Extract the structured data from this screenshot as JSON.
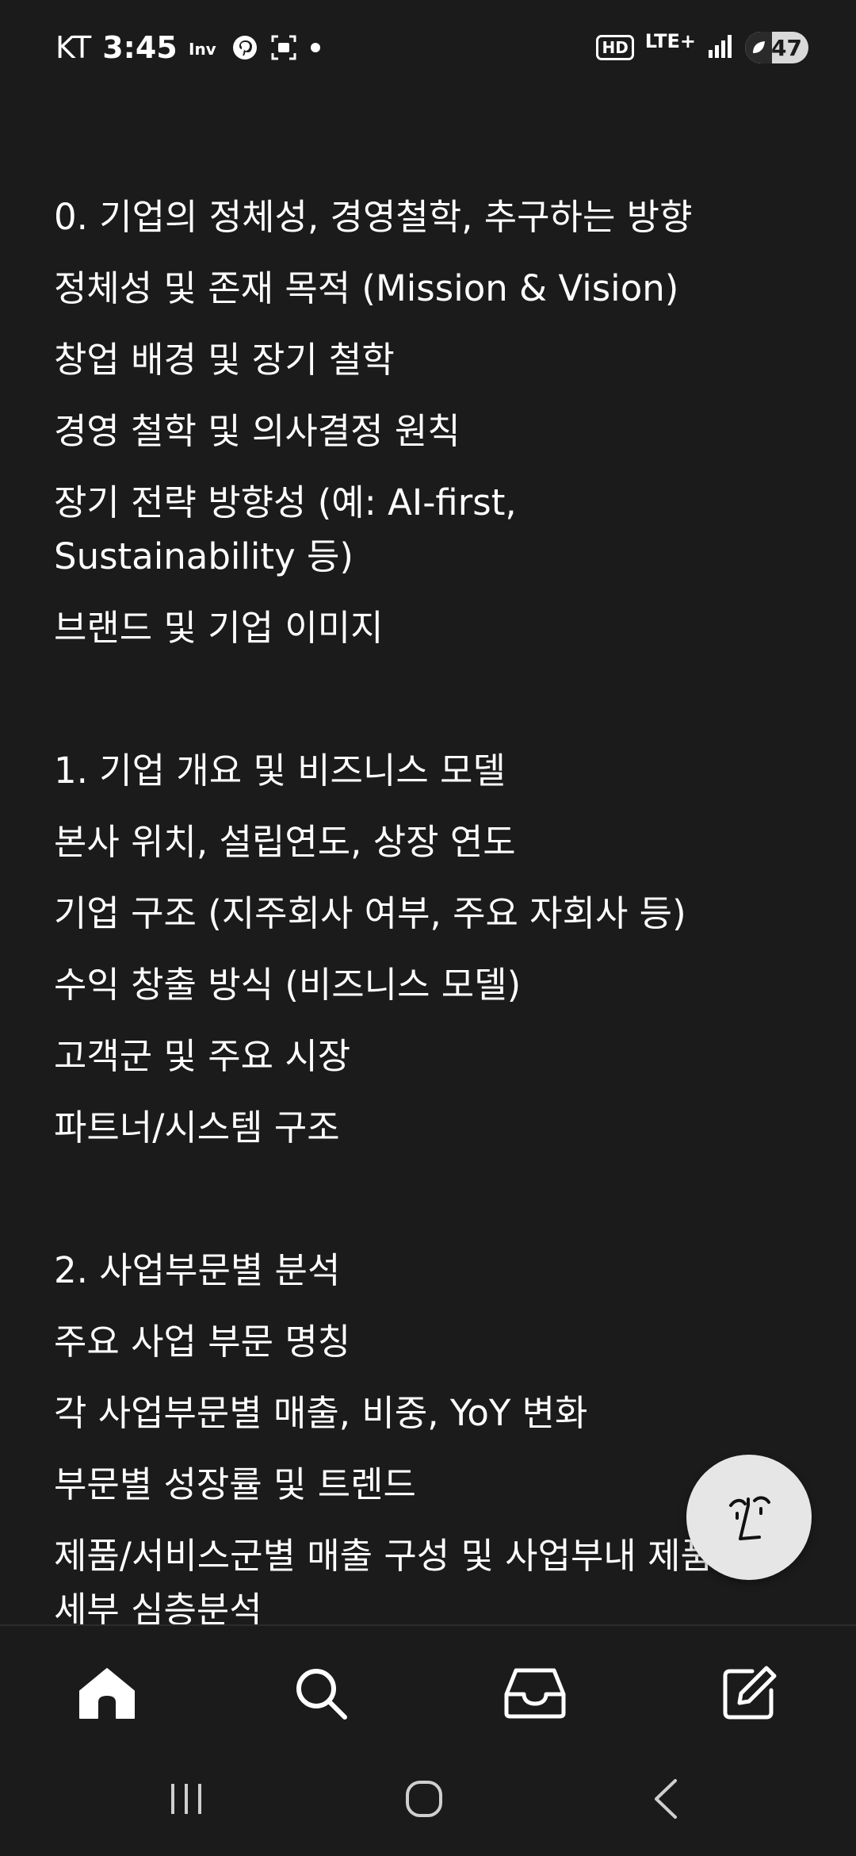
{
  "status_bar": {
    "carrier": "KT",
    "time": "3:45",
    "app_icon_label": "Inv",
    "network_hd": "HD",
    "network_lte": "LTE+",
    "battery_percent": "47"
  },
  "content": {
    "section0": [
      "0. 기업의 정체성, 경영철학, 추구하는 방향",
      "정체성 및 존재 목적 (Mission & Vision)",
      "창업 배경 및 장기 철학",
      "경영 철학 및 의사결정 원칙",
      "장기 전략 방향성 (예: AI-first, Sustainability 등)",
      "브랜드 및 기업 이미지"
    ],
    "section1": [
      "1. 기업 개요 및 비즈니스 모델",
      "본사 위치, 설립연도, 상장 연도",
      "기업 구조 (지주회사 여부, 주요 자회사 등)",
      "수익 창출 방식 (비즈니스 모델)",
      "고객군 및 주요 시장",
      "파트너/시스템 구조"
    ],
    "section2": [
      "2. 사업부문별 분석",
      "주요 사업 부문 명칭",
      "각 사업부문별 매출, 비중, YoY 변화",
      "부문별 성장률 및 트렌드",
      "제품/서비스군별 매출 구성 및 사업부내 제품 세부 심층분석"
    ]
  },
  "nav": {
    "items": [
      "home-icon",
      "search-icon",
      "inbox-icon",
      "compose-icon"
    ]
  },
  "colors": {
    "background": "#1b1b1b",
    "text": "#ffffff",
    "fab": "#e6e6e6"
  }
}
